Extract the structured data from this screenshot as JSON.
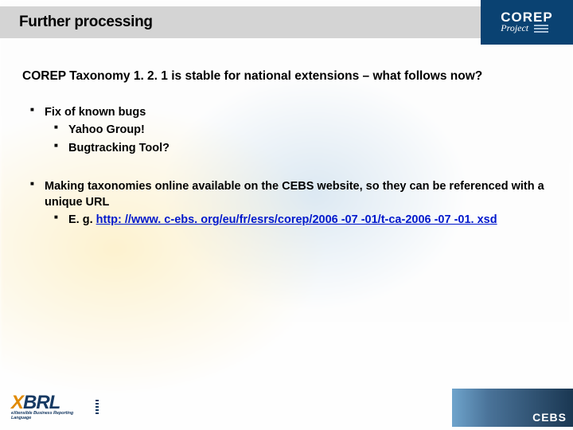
{
  "header": {
    "title": "Further processing",
    "logo": {
      "line1": "COREP",
      "line2": "Project"
    }
  },
  "main": {
    "heading": "COREP Taxonomy 1. 2. 1 is stable for national extensions – what follows now?",
    "bullets": [
      {
        "text": "Fix of known bugs",
        "sub": [
          {
            "text": "Yahoo Group!"
          },
          {
            "text": "Bugtracking Tool?"
          }
        ]
      },
      {
        "text": "Making taxonomies online available on the CEBS website, so they can be referenced with a unique URL",
        "sub": [
          {
            "prefix": "E. g. ",
            "link": "http: //www. c-ebs. org/eu/fr/esrs/corep/2006 -07 -01/t-ca-2006 -07 -01. xsd"
          }
        ]
      }
    ]
  },
  "footer": {
    "xbrl": {
      "x": "X",
      "brl": "BRL",
      "sub": "eXtensible Business Reporting Language"
    },
    "cebs": "CEBS"
  }
}
